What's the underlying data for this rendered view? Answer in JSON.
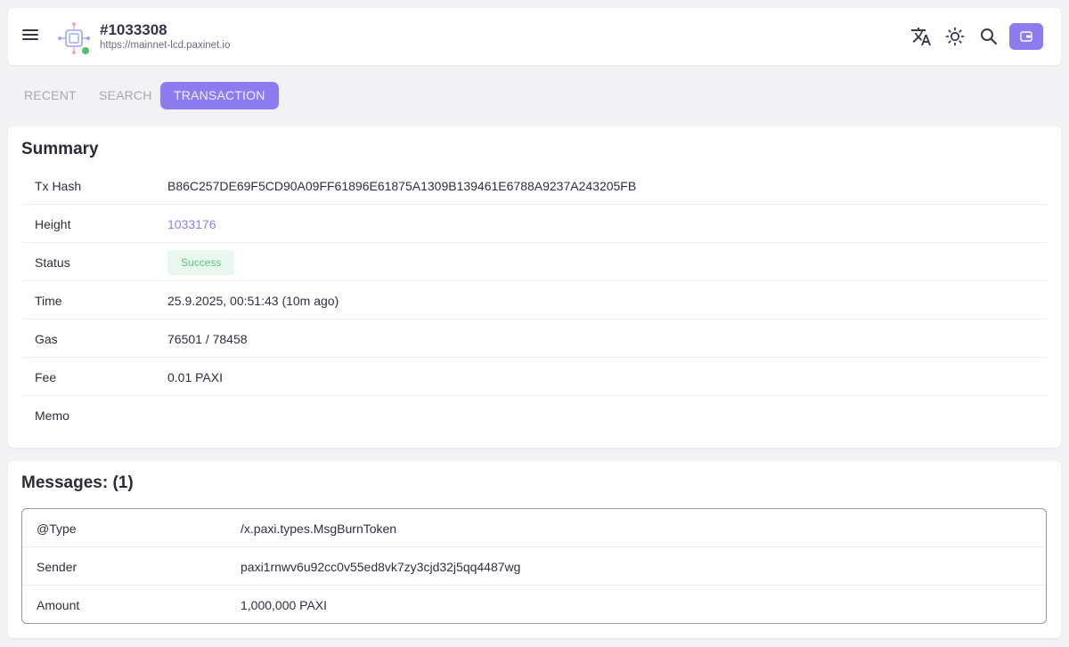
{
  "header": {
    "title": "#1033308",
    "endpoint": "https://mainnet-lcd.paxinet.io",
    "status_color": "#4cc46f",
    "accent_color": "#8c7cf0",
    "icons": [
      "menu-icon",
      "chain-logo-icon",
      "translate-icon",
      "theme-sun-icon",
      "search-icon",
      "wallet-icon"
    ]
  },
  "tabs": [
    {
      "label": "RECENT",
      "active": false
    },
    {
      "label": "SEARCH",
      "active": false
    },
    {
      "label": "TRANSACTION",
      "active": true
    }
  ],
  "summary": {
    "heading": "Summary",
    "rows": [
      {
        "key": "Tx Hash",
        "value": "B86C257DE69F5CD90A09FF61896E61875A1309B139461E6788A9237A243205FB"
      },
      {
        "key": "Height",
        "value": "1033176"
      },
      {
        "key": "Status",
        "value": "Success"
      },
      {
        "key": "Time",
        "value": "25.9.2025, 00:51:43 (10m ago)"
      },
      {
        "key": "Gas",
        "value": "76501 / 78458"
      },
      {
        "key": "Fee",
        "value": "0.01 PAXI"
      },
      {
        "key": "Memo",
        "value": ""
      }
    ]
  },
  "messages": {
    "heading": "Messages: (1)",
    "rows": [
      {
        "key": "@Type",
        "value": "/x.paxi.types.MsgBurnToken"
      },
      {
        "key": "Sender",
        "value": "paxi1rnwv6u92cc0v55ed8vk7zy3cjd32j5qq4487wg"
      },
      {
        "key": "Amount",
        "value": "1,000,000 PAXI"
      }
    ]
  }
}
